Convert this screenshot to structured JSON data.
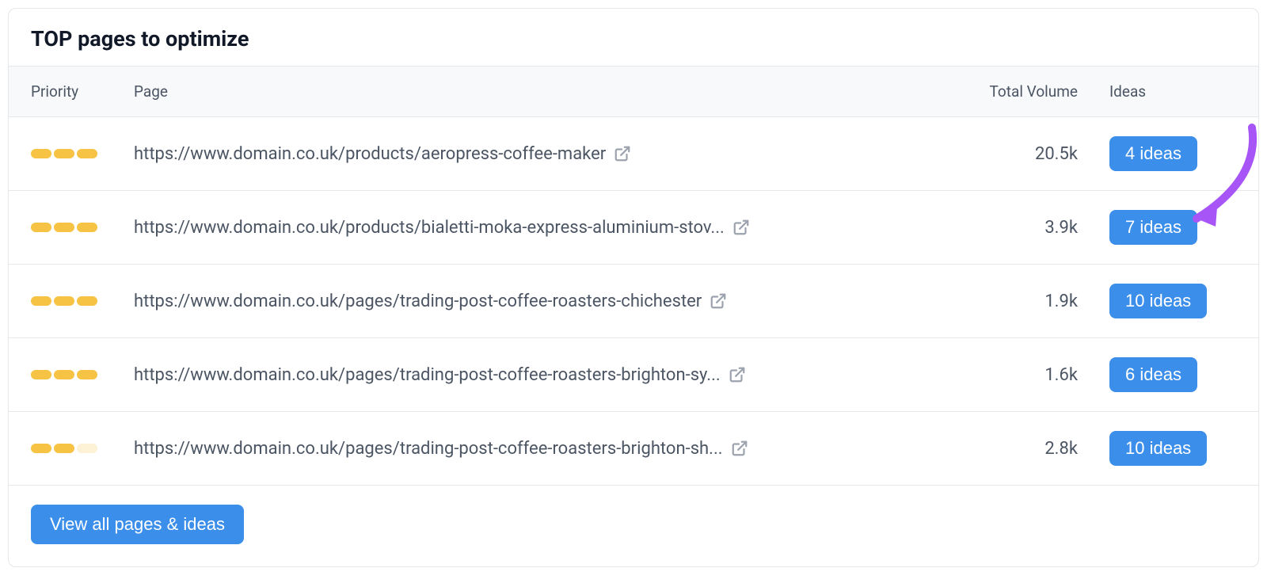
{
  "card": {
    "title": "TOP pages to optimize",
    "headers": {
      "priority": "Priority",
      "page": "Page",
      "volume": "Total Volume",
      "ideas": "Ideas"
    },
    "rows": [
      {
        "priority_segments": [
          "full",
          "full",
          "full"
        ],
        "page_url": "https://www.domain.co.uk/products/aeropress-coffee-maker",
        "volume": "20.5k",
        "ideas_label": "4 ideas"
      },
      {
        "priority_segments": [
          "full",
          "full",
          "full"
        ],
        "page_url": "https://www.domain.co.uk/products/bialetti-moka-express-aluminium-stov...",
        "volume": "3.9k",
        "ideas_label": "7 ideas"
      },
      {
        "priority_segments": [
          "full",
          "full",
          "full"
        ],
        "page_url": "https://www.domain.co.uk/pages/trading-post-coffee-roasters-chichester",
        "volume": "1.9k",
        "ideas_label": "10 ideas"
      },
      {
        "priority_segments": [
          "full",
          "full",
          "full"
        ],
        "page_url": "https://www.domain.co.uk/pages/trading-post-coffee-roasters-brighton-sy...",
        "volume": "1.6k",
        "ideas_label": "6 ideas"
      },
      {
        "priority_segments": [
          "full",
          "full",
          "dim"
        ],
        "page_url": "https://www.domain.co.uk/pages/trading-post-coffee-roasters-brighton-sh...",
        "volume": "2.8k",
        "ideas_label": "10 ideas"
      }
    ],
    "footer_button": "View all pages & ideas"
  },
  "annotation": {
    "arrow_color": "#a855f7",
    "target_row_index": 1
  }
}
